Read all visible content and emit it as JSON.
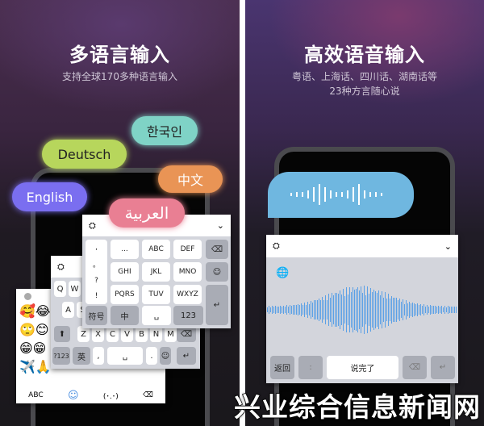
{
  "left": {
    "title": "多语言输入",
    "subtitle": "支持全球170多种语言输入",
    "languages": {
      "korean": "한국인",
      "german": "Deutsch",
      "chinese": "中文",
      "english": "English",
      "arabic": "العربية"
    },
    "colors": {
      "korean": "#7fd3c6",
      "german": "#b7d65c",
      "chinese": "#e99455",
      "english": "#7a6ef0",
      "arabic": "#e97f93"
    },
    "t9": {
      "punct": [
        ",",
        "。",
        "?",
        "!"
      ],
      "keys": [
        "...",
        "ABC",
        "DEF",
        "GHI",
        "JKL",
        "MNO",
        "PQRS",
        "TUV",
        "WXYZ"
      ],
      "nums": [
        "1",
        "2",
        "3",
        "4",
        "5",
        "6",
        "7",
        "8",
        "9"
      ],
      "symbol": "符号",
      "lang": "中",
      "num": "123"
    },
    "qwerty": {
      "row1": [
        "Q",
        "W"
      ],
      "row2": [
        "A",
        "S"
      ],
      "row3": [
        "Z",
        "X",
        "C",
        "V",
        "B",
        "N",
        "M"
      ],
      "num": "?123",
      "lang": "英",
      "comma": ",",
      "period": "."
    },
    "emoji": {
      "rows": [
        "🥰😂",
        "🙄😊",
        "😁😁",
        "✈️🙏",
        "",
        "",
        ""
      ],
      "abc": "ABC",
      "kaomoji": "(･.･)"
    }
  },
  "right": {
    "title": "高效语音输入",
    "subtitle_line1": "粤语、上海话、四川话、湖南话等",
    "subtitle_line2": "23种方言随心说",
    "keyboard": {
      "back": "返回",
      "colon": ":",
      "done": "说完了"
    },
    "bubble_color": "#6fb7e0"
  },
  "watermark": "兴业综合信息新闻网"
}
